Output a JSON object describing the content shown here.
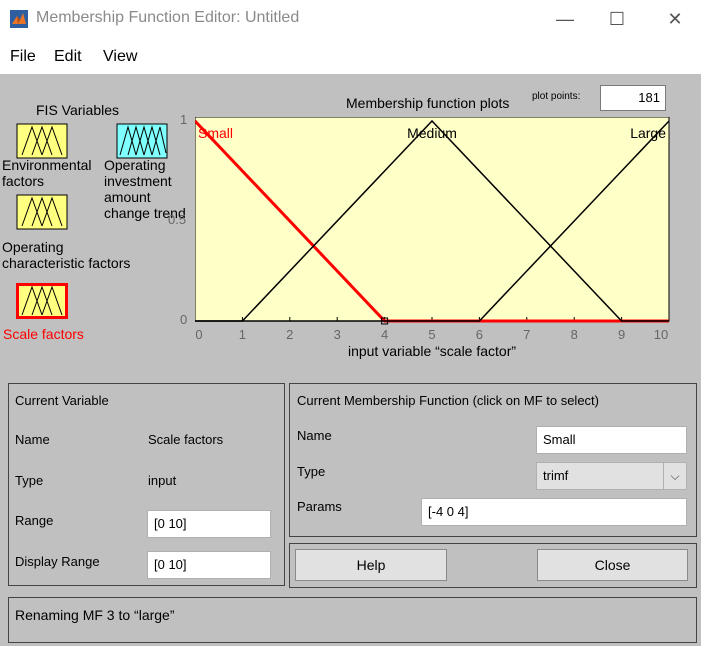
{
  "window": {
    "title": "Membership Function Editor: Untitled",
    "controls": {
      "minimize": "—",
      "maximize": "☐",
      "close": "✕"
    }
  },
  "menu": [
    "File",
    "Edit",
    "View"
  ],
  "fis_variables": {
    "heading": "FIS Variables",
    "items": [
      {
        "label_lines": [
          "Environmental",
          "factors"
        ],
        "icon_color": "#ffff80",
        "selected": false
      },
      {
        "label_lines": [
          "Operating",
          "investment",
          "amount",
          "change trend"
        ],
        "icon_color": "#80ffff",
        "selected": false
      },
      {
        "label_lines": [
          "Operating",
          "characteristic factors"
        ],
        "icon_color": "#ffff80",
        "selected": false
      },
      {
        "label_lines": [
          "Scale factors"
        ],
        "icon_color": "#ffff80",
        "selected": true,
        "label_color": "#ff0000"
      }
    ]
  },
  "plot": {
    "title": "Membership function plots",
    "plot_points_label": "plot points:",
    "plot_points_value": "181"
  },
  "chart_data": {
    "type": "line",
    "xlabel": "input variable “scale factor”",
    "xlim": [
      0,
      10
    ],
    "ylim": [
      0,
      1
    ],
    "x_ticks": [
      "0",
      "1",
      "2",
      "3",
      "4",
      "5",
      "6",
      "7",
      "8",
      "9",
      "10"
    ],
    "y_ticks": [
      "0",
      "0.5",
      "1"
    ],
    "background": "#ffffc8",
    "series": [
      {
        "name": "Small",
        "points": [
          [
            0,
            1
          ],
          [
            4,
            0
          ],
          [
            10,
            0
          ]
        ],
        "color": "#ff0000",
        "selected": true
      },
      {
        "name": "Medium",
        "points": [
          [
            0,
            0
          ],
          [
            1,
            0
          ],
          [
            5,
            1
          ],
          [
            9,
            0
          ],
          [
            10,
            0
          ]
        ],
        "color": "#000000",
        "selected": false
      },
      {
        "name": "Large",
        "points": [
          [
            0,
            0
          ],
          [
            6,
            0
          ],
          [
            10,
            1
          ]
        ],
        "color": "#000000",
        "selected": false
      }
    ]
  },
  "current_variable": {
    "heading": "Current Variable",
    "name_label": "Name",
    "name_value": "Scale factors",
    "type_label": "Type",
    "type_value": "input",
    "range_label": "Range",
    "range_value": "[0 10]",
    "display_range_label": "Display Range",
    "display_range_value": "[0 10]"
  },
  "current_mf": {
    "heading": "Current Membership Function (click on MF to select)",
    "name_label": "Name",
    "name_value": "Small",
    "type_label": "Type",
    "type_value": "trimf",
    "params_label": "Params",
    "params_value": "[-4 0 4]"
  },
  "buttons": {
    "help": "Help",
    "close": "Close"
  },
  "status": "Renaming MF 3 to “large”"
}
